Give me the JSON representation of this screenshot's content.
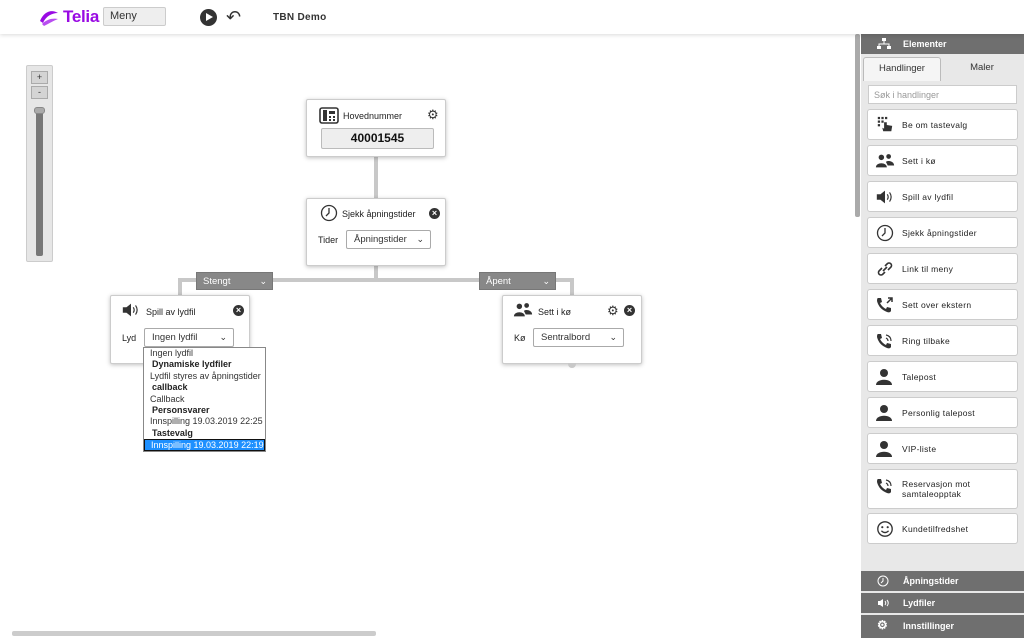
{
  "header": {
    "brand": "Telia",
    "menu_label": "Meny",
    "title": "TBN Demo"
  },
  "zoom": {
    "plus": "+",
    "minus": "-"
  },
  "nodes": {
    "main_number": {
      "title": "Hovednummer",
      "number": "40001545"
    },
    "opening_hours": {
      "title": "Sjekk åpningstider",
      "field_label": "Tider",
      "field_value": "Åpningstider"
    },
    "play_audio": {
      "title": "Spill av lydfil",
      "field_label": "Lyd",
      "field_value": "Ingen lydfil"
    },
    "queue": {
      "title": "Sett i kø",
      "field_label": "Kø",
      "field_value": "Sentralbord"
    }
  },
  "branches": {
    "closed": "Stengt",
    "open": "Åpent"
  },
  "dropdown": [
    {
      "text": "Ingen lydfil",
      "kind": "option"
    },
    {
      "text": "Dynamiske lydfiler",
      "kind": "group"
    },
    {
      "text": "Lydfil styres av åpningstider",
      "kind": "option"
    },
    {
      "text": "callback",
      "kind": "group"
    },
    {
      "text": "Callback",
      "kind": "option"
    },
    {
      "text": "Personsvarer",
      "kind": "group"
    },
    {
      "text": "Innspilling 19.03.2019 22:25",
      "kind": "option"
    },
    {
      "text": "Tastevalg",
      "kind": "group"
    },
    {
      "text": "Innspilling 19.03.2019 22:19",
      "kind": "selected"
    }
  ],
  "panel": {
    "elements_header": "Elementer",
    "tabs": [
      "Handlinger",
      "Maler"
    ],
    "search_placeholder": "Søk i handlinger",
    "actions": [
      "Be om tastevalg",
      "Sett i kø",
      "Spill av lydfil",
      "Sjekk åpningstider",
      "Link til meny",
      "Sett over ekstern",
      "Ring tilbake",
      "Talepost",
      "Personlig talepost",
      "VIP-liste",
      "Reservasjon mot samtaleopptak",
      "Kundetilfredshet"
    ],
    "footer": [
      "Åpningstider",
      "Lydfiler",
      "Innstillinger"
    ]
  },
  "colors": {
    "brand": "#990ae3",
    "panel_header": "#6f6f6f",
    "branch": "#888888",
    "selected": "#1e90ff"
  }
}
